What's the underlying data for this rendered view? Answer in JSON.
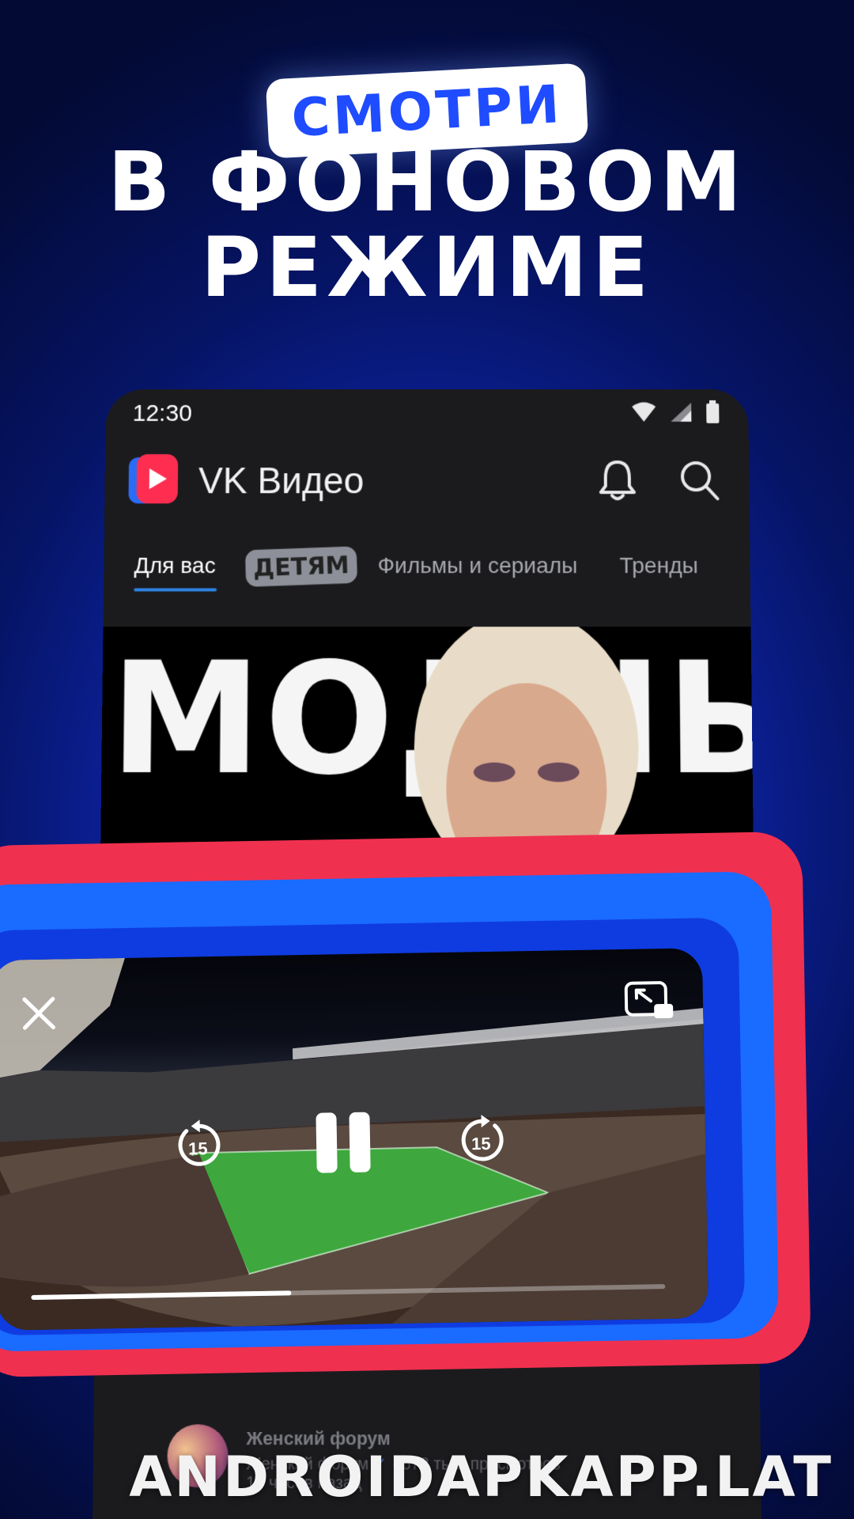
{
  "promo": {
    "badge": "СМОТРИ",
    "line1": "В ФОНОВОМ",
    "line2": "РЕЖИМЕ"
  },
  "status_bar": {
    "time": "12:30",
    "icons": [
      "wifi-icon",
      "signal-icon",
      "battery-icon"
    ]
  },
  "app_bar": {
    "title": "VK Видео",
    "icons": [
      "vk-video-logo",
      "bell-icon",
      "search-icon"
    ]
  },
  "tabs": [
    {
      "label": "Для вас",
      "active": true
    },
    {
      "label": "ДЕТЯМ",
      "active": false
    },
    {
      "label": "Фильмы и сериалы",
      "active": false
    },
    {
      "label": "Тренды",
      "active": false
    }
  ],
  "banner": {
    "text": "МОДНЫЙ"
  },
  "mini_player": {
    "rewind_seconds": "15",
    "forward_seconds": "15",
    "progress": 0.41,
    "icons": [
      "close-icon",
      "picture-in-picture-icon",
      "rewind-15-icon",
      "pause-icon",
      "forward-15-icon"
    ]
  },
  "feed_item": {
    "title": "Женский форум",
    "channel": "Женский форум",
    "views": "· 678 тыс. просмотров",
    "time": "18 часов назад"
  },
  "watermark": "ANDROIDAPKAPP.LAT",
  "colors": {
    "accent_blue": "#1f4cff",
    "frame_red": "#f0304f",
    "frame_blue": "#1a6bff",
    "tab_underline": "#2d81e0"
  }
}
